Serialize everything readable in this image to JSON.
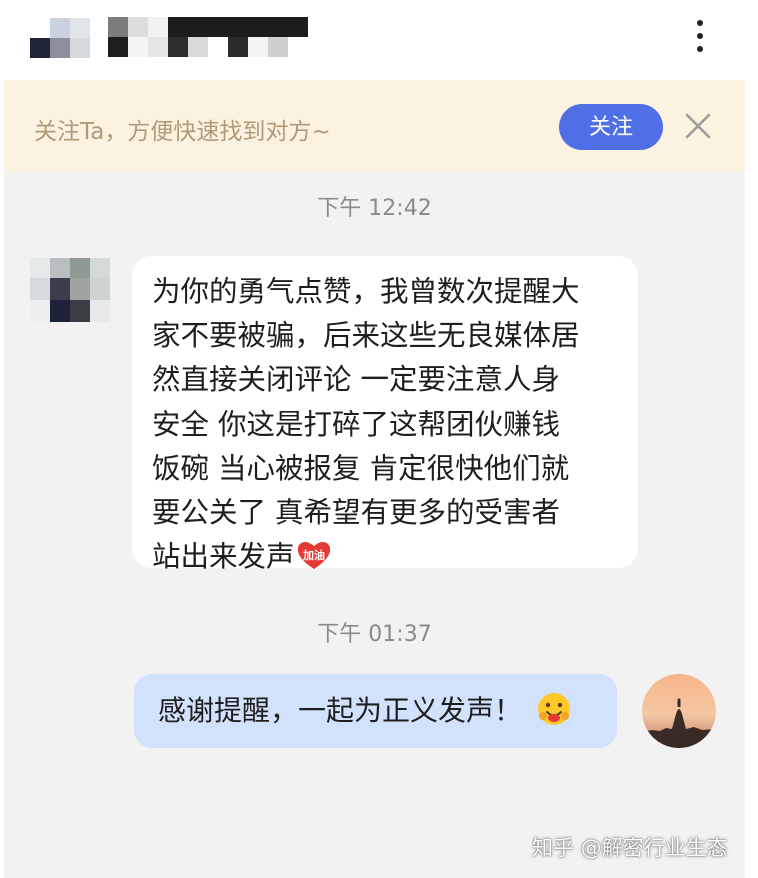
{
  "header": {
    "contact_name": "",
    "more_icon": "more-vertical-icon"
  },
  "banner": {
    "text": "关注Ta，方便快速找到对方~",
    "follow_label": "关注",
    "close_icon": "close-icon"
  },
  "messages": [
    {
      "type": "timestamp",
      "text": "下午 12:42"
    },
    {
      "type": "incoming",
      "lines": [
        "为你的勇气点赞，我曾数次提醒大",
        "家不要被骗，后来这些无良媒体居",
        "然直接关闭评论 一定要注意人身",
        "安全 你这是打碎了这帮团伙赚钱",
        "饭碗 当心被报复 肯定很快他们就",
        "要公关了 真希望有更多的受害者",
        "站出来发声"
      ],
      "sticker_label": "加油"
    },
    {
      "type": "timestamp",
      "text": "下午 01:37"
    },
    {
      "type": "outgoing",
      "text": "感谢提醒，一起为正义发声！",
      "emoji": "hug-emoji-icon"
    }
  ],
  "watermark": "知乎 @解密行业生态",
  "colors": {
    "banner_bg": "#fbf3df",
    "banner_text": "#b1997a",
    "follow_button": "#4f6fe6",
    "chat_bg": "#f2f2f3",
    "outgoing_bubble": "#d3e2fc",
    "incoming_bubble": "#ffffff"
  }
}
